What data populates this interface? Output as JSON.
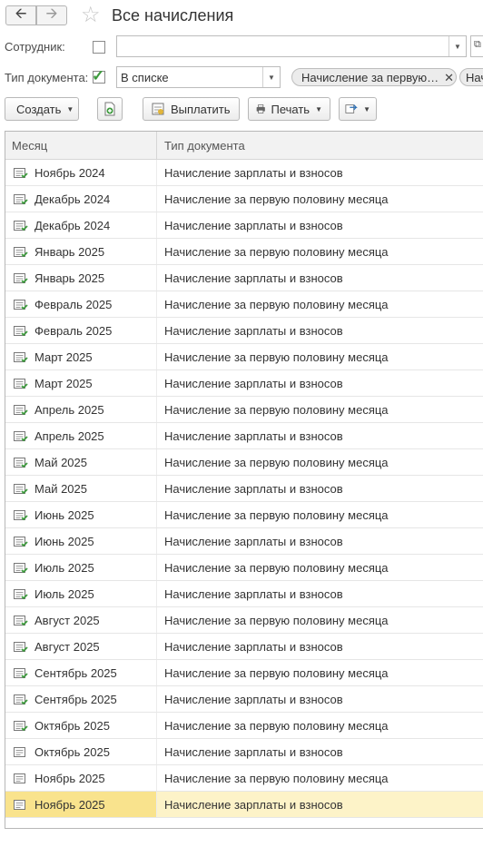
{
  "header": {
    "title": "Все начисления"
  },
  "filters": {
    "employee_label": "Сотрудник:",
    "employee_value": "",
    "doc_type_label": "Тип документа:",
    "doc_type_mode": "В списке",
    "doc_type_tags": [
      "Начисление за первую…",
      "Нач"
    ]
  },
  "toolbar": {
    "create_label": "Создать",
    "pay_label": "Выплатить",
    "print_label": "Печать"
  },
  "table": {
    "columns": [
      "Месяц",
      "Тип документа"
    ],
    "rows": [
      {
        "month": "Ноябрь 2024",
        "type": "Начисление зарплаты и взносов",
        "posted": true
      },
      {
        "month": "Декабрь 2024",
        "type": "Начисление за первую половину месяца",
        "posted": true
      },
      {
        "month": "Декабрь 2024",
        "type": "Начисление зарплаты и взносов",
        "posted": true
      },
      {
        "month": "Январь 2025",
        "type": "Начисление за первую половину месяца",
        "posted": true
      },
      {
        "month": "Январь 2025",
        "type": "Начисление зарплаты и взносов",
        "posted": true
      },
      {
        "month": "Февраль 2025",
        "type": "Начисление за первую половину месяца",
        "posted": true
      },
      {
        "month": "Февраль 2025",
        "type": "Начисление зарплаты и взносов",
        "posted": true
      },
      {
        "month": "Март 2025",
        "type": "Начисление за первую половину месяца",
        "posted": true
      },
      {
        "month": "Март 2025",
        "type": "Начисление зарплаты и взносов",
        "posted": true
      },
      {
        "month": "Апрель 2025",
        "type": "Начисление за первую половину месяца",
        "posted": true
      },
      {
        "month": "Апрель 2025",
        "type": "Начисление зарплаты и взносов",
        "posted": true
      },
      {
        "month": "Май 2025",
        "type": "Начисление за первую половину месяца",
        "posted": true
      },
      {
        "month": "Май 2025",
        "type": "Начисление зарплаты и взносов",
        "posted": true
      },
      {
        "month": "Июнь 2025",
        "type": "Начисление за первую половину месяца",
        "posted": true
      },
      {
        "month": "Июнь 2025",
        "type": "Начисление зарплаты и взносов",
        "posted": true
      },
      {
        "month": "Июль 2025",
        "type": "Начисление за первую половину месяца",
        "posted": true
      },
      {
        "month": "Июль 2025",
        "type": "Начисление зарплаты и взносов",
        "posted": true
      },
      {
        "month": "Август 2025",
        "type": "Начисление за первую половину месяца",
        "posted": true
      },
      {
        "month": "Август 2025",
        "type": "Начисление зарплаты и взносов",
        "posted": true
      },
      {
        "month": "Сентябрь 2025",
        "type": "Начисление за первую половину месяца",
        "posted": true
      },
      {
        "month": "Сентябрь 2025",
        "type": "Начисление зарплаты и взносов",
        "posted": true
      },
      {
        "month": "Октябрь 2025",
        "type": "Начисление за первую половину месяца",
        "posted": true
      },
      {
        "month": "Октябрь 2025",
        "type": "Начисление зарплаты и взносов",
        "posted": false
      },
      {
        "month": "Ноябрь 2025",
        "type": "Начисление за первую половину месяца",
        "posted": false
      },
      {
        "month": "Ноябрь 2025",
        "type": "Начисление зарплаты и взносов",
        "posted": false,
        "selected": true
      }
    ]
  },
  "colors": {
    "selected_row": "#fdf3c8",
    "selected_cell": "#f9e38d",
    "posted_icon": "#3d9a3d"
  }
}
